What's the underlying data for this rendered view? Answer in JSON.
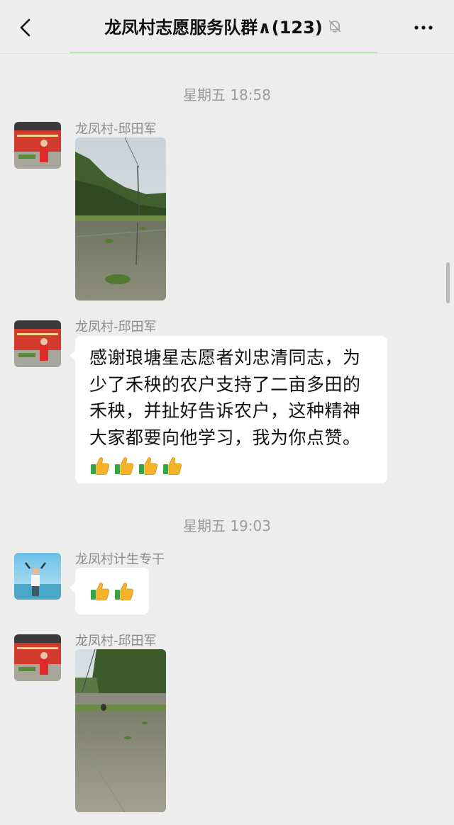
{
  "header": {
    "title": "龙凤村志愿服务队群∧(123)",
    "back_icon": "chevron-left-icon",
    "mute_icon": "bell-off-icon",
    "more_icon": "more-dots-icon"
  },
  "timestamps": [
    "星期五 18:58",
    "星期五 19:03"
  ],
  "messages": [
    {
      "sender": "龙凤村-邱田军",
      "type": "image",
      "image": "rice-paddy-photo"
    },
    {
      "sender": "龙凤村-邱田军",
      "type": "text",
      "lines": [
        "感谢琅塘星志愿者刘忠清同志，为",
        "少了禾秧的农户支持了二亩多田的",
        "禾秧，并扯好告诉农户，这种精神",
        "大家都要向他学习，我为你点赞。"
      ],
      "emoji": "thumbs-up-icon",
      "emoji_count": 4
    },
    {
      "sender": "龙凤村计生专干",
      "type": "emoji",
      "emoji": "thumbs-up-icon",
      "emoji_count": 2
    },
    {
      "sender": "龙凤村-邱田军",
      "type": "image",
      "image": "planting-field-photo"
    }
  ],
  "colors": {
    "background": "#ededed",
    "bubble": "#ffffff",
    "header_underline": "#b8e6b0",
    "timestamp": "#9b9b9b",
    "sender": "#8a8a8a"
  }
}
